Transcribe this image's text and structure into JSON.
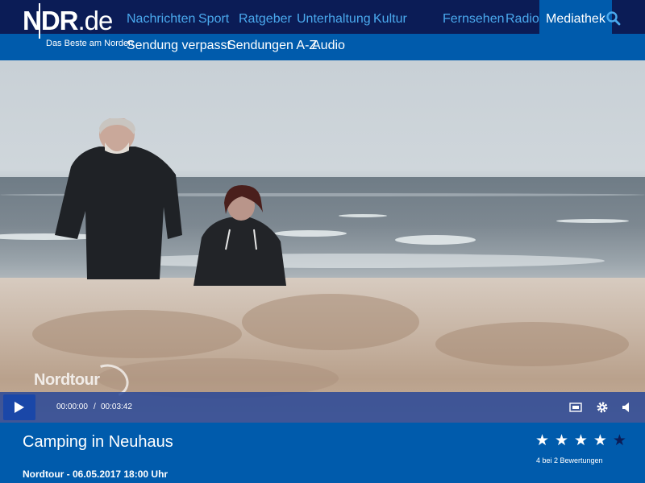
{
  "brand": {
    "logo_main": "NDR",
    "logo_tld": ".de",
    "claim": "Das Beste am Norden"
  },
  "nav": {
    "items": [
      {
        "label": "Nachrichten"
      },
      {
        "label": "Sport"
      },
      {
        "label": "Ratgeber"
      },
      {
        "label": "Unterhaltung"
      },
      {
        "label": "Kultur"
      },
      {
        "label": "Fernsehen"
      },
      {
        "label": "Radio"
      },
      {
        "label": "Mediathek",
        "active": true
      }
    ],
    "search_icon": "search-icon"
  },
  "subnav": {
    "items": [
      {
        "label": "Sendung verpasst"
      },
      {
        "label": "Sendungen A-Z"
      },
      {
        "label": "Audio"
      }
    ]
  },
  "video": {
    "watermark": "Nordtour"
  },
  "player": {
    "current_time": "00:00:00",
    "separator": "/",
    "duration": "00:03:42",
    "icons": [
      "play-icon",
      "fullscreen-icon",
      "settings-gear-icon",
      "volume-icon"
    ]
  },
  "info": {
    "title": "Camping in Neuhaus",
    "meta": "Nordtour - 06.05.2017 18:00 Uhr",
    "rating": {
      "value": 4,
      "max": 5,
      "text": "4 bei 2 Bewertungen"
    }
  },
  "colors": {
    "topbar": "#0b1c56",
    "accent": "#005bac",
    "nav_link": "#4aa9ee",
    "controls": "#2846a0"
  }
}
